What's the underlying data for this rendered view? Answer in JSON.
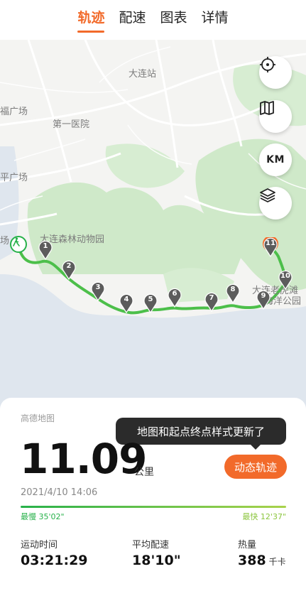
{
  "tabs": [
    {
      "label": "轨迹",
      "active": true
    },
    {
      "label": "配速",
      "active": false
    },
    {
      "label": "图表",
      "active": false
    },
    {
      "label": "详情",
      "active": false
    }
  ],
  "map": {
    "labels": {
      "dalian_station": "大连站",
      "first_hospital": "第一医院",
      "zoo": "大连森林动物园",
      "park": "大连老虎滩",
      "park_suffix": "海洋公园",
      "plaza_1": "福广场",
      "plaza_2": "平广场",
      "plaza_3": "场"
    },
    "km_markers": [
      "1",
      "2",
      "3",
      "4",
      "5",
      "6",
      "7",
      "8",
      "9",
      "10",
      "11"
    ],
    "controls": {
      "locate_icon": "crosshair-icon",
      "map_type_icon": "map-icon",
      "km_label": "KM",
      "layers_icon": "layers-icon"
    },
    "start_icon": "walker-icon"
  },
  "card": {
    "provider": "高德地图",
    "distance": "11.09",
    "distance_unit": "公里",
    "datetime": "2021/4/10 14:06",
    "tooltip": "地图和起点终点样式更新了",
    "dynamic_button": "动态轨迹",
    "pace_slow": "最慢 35'02\"",
    "pace_fast": "最快 12'37\"",
    "stats": [
      {
        "label": "运动时间",
        "value": "03:21:29",
        "unit": ""
      },
      {
        "label": "平均配速",
        "value": "18'10\"",
        "unit": ""
      },
      {
        "label": "热量",
        "value": "388",
        "unit": "千卡"
      }
    ]
  },
  "colors": {
    "accent": "#f26a2a",
    "route": "#4cbf4a",
    "pin": "#5c5c5c",
    "sea": "#dfe6ee",
    "land": "#f4f4f2",
    "green_area": "#cfe9c9"
  }
}
